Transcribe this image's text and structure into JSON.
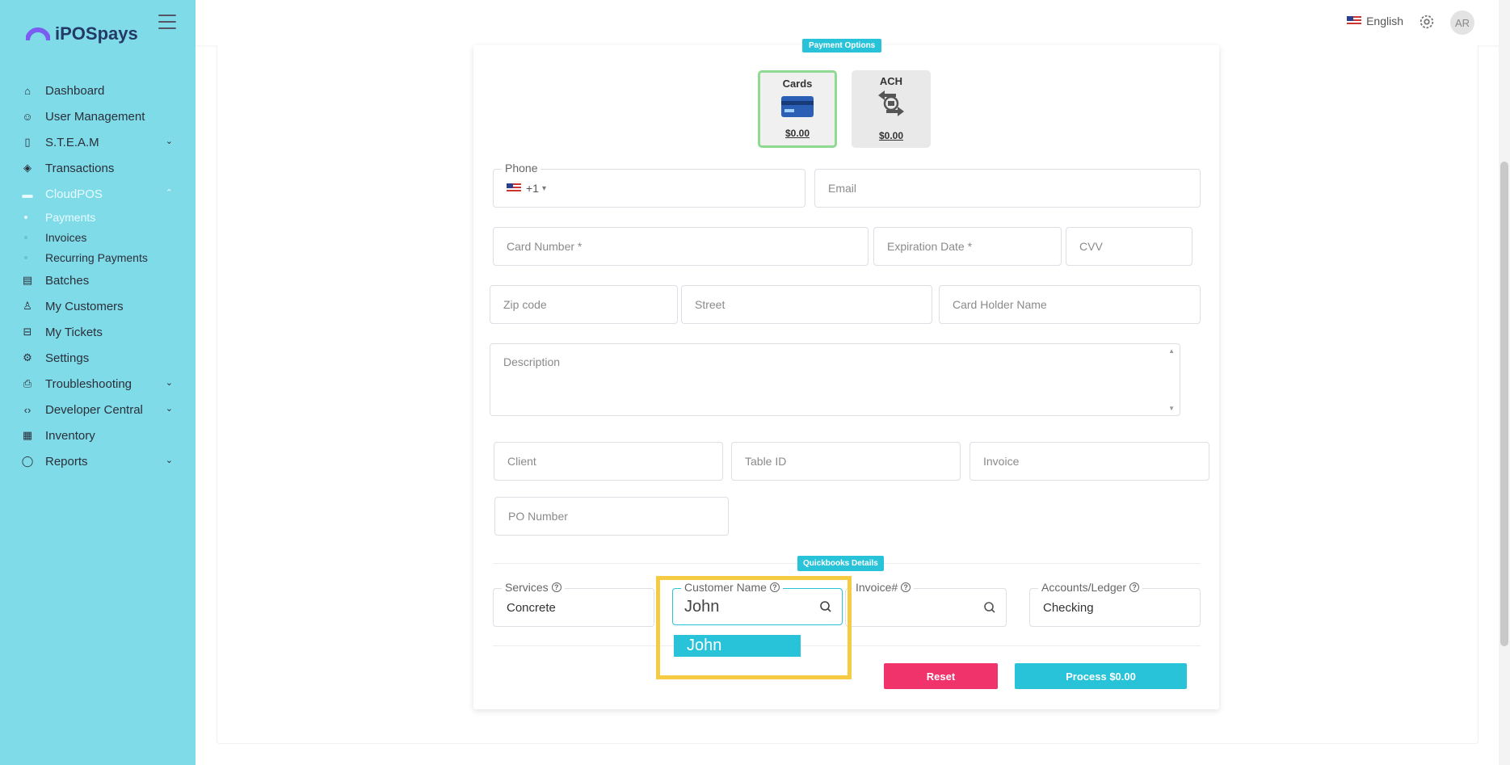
{
  "brand": {
    "name": "iPOSpays"
  },
  "sidebar": {
    "items": [
      {
        "label": "Dashboard",
        "icon": "home-icon"
      },
      {
        "label": "User Management",
        "icon": "users-icon"
      },
      {
        "label": "S.T.E.A.M",
        "icon": "device-icon",
        "expandable": true
      },
      {
        "label": "Transactions",
        "icon": "layers-icon"
      },
      {
        "label": "CloudPOS",
        "icon": "card-icon",
        "expandable": true,
        "active": true
      },
      {
        "label": "Batches",
        "icon": "document-icon"
      },
      {
        "label": "My Customers",
        "icon": "user-icon"
      },
      {
        "label": "My Tickets",
        "icon": "inbox-icon"
      },
      {
        "label": "Settings",
        "icon": "gear-icon"
      },
      {
        "label": "Troubleshooting",
        "icon": "printer-icon",
        "expandable": true
      },
      {
        "label": "Developer Central",
        "icon": "code-icon",
        "expandable": true
      },
      {
        "label": "Inventory",
        "icon": "file-icon"
      },
      {
        "label": "Reports",
        "icon": "chat-icon",
        "expandable": true
      }
    ],
    "cloudpos_subitems": [
      {
        "label": "Payments",
        "active": true
      },
      {
        "label": "Invoices"
      },
      {
        "label": "Recurring Payments"
      }
    ]
  },
  "topbar": {
    "language": "English",
    "avatar_initials": "AR"
  },
  "form": {
    "payment_options_label": "Payment Options",
    "options": [
      {
        "label": "Cards",
        "amount": "$0.00",
        "selected": true
      },
      {
        "label": "ACH",
        "amount": "$0.00"
      }
    ],
    "phone": {
      "label": "Phone",
      "prefix": "+1",
      "value": ""
    },
    "email": {
      "placeholder": "Email"
    },
    "card_number": {
      "placeholder": "Card Number *"
    },
    "expiration": {
      "placeholder": "Expiration Date *"
    },
    "cvv": {
      "placeholder": "CVV"
    },
    "zip": {
      "placeholder": "Zip code"
    },
    "street": {
      "placeholder": "Street"
    },
    "card_holder": {
      "placeholder": "Card Holder Name"
    },
    "description": {
      "placeholder": "Description"
    },
    "client": {
      "placeholder": "Client"
    },
    "table_id": {
      "placeholder": "Table ID"
    },
    "invoice": {
      "placeholder": "Invoice"
    },
    "po_number": {
      "placeholder": "PO Number"
    },
    "quickbooks_label": "Quickbooks Details",
    "services": {
      "label": "Services",
      "value": "Concrete"
    },
    "customer_name": {
      "label": "Customer Name",
      "value": "John"
    },
    "invoice_no": {
      "label": "Invoice#",
      "value": ""
    },
    "accounts_ledger": {
      "label": "Accounts/Ledger",
      "value": "Checking"
    },
    "customer_suggestion": "John",
    "reset_label": "Reset",
    "process_label": "Process $0.00"
  },
  "colors": {
    "sidebar": "#7fdbe8",
    "accent": "#29c3d9",
    "reset": "#f0336b",
    "highlight": "#f5cb43"
  }
}
